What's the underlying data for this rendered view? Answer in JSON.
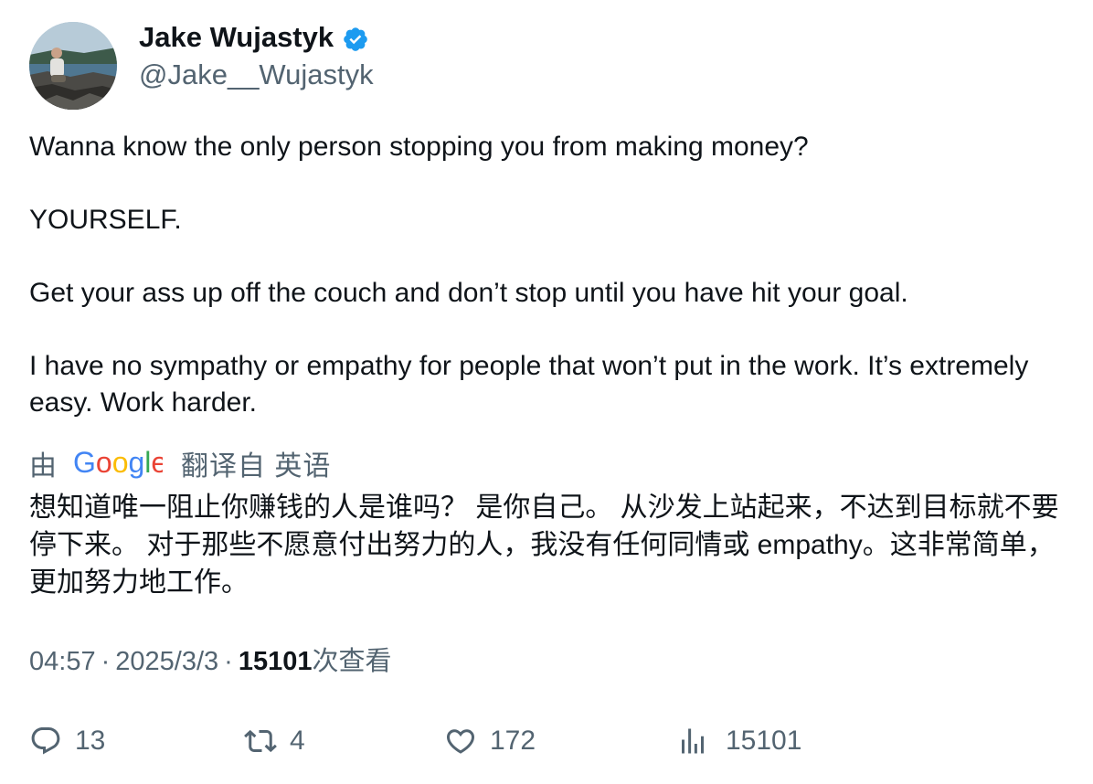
{
  "author": {
    "display_name": "Jake Wujastyk",
    "handle": "@Jake__Wujastyk",
    "verified": true,
    "verified_color": "#1d9bf0"
  },
  "tweet": {
    "paragraphs": [
      "Wanna know the only person stopping you from making money?",
      "YOURSELF.",
      "Get your ass up off the couch and don’t stop until you have hit your goal.",
      "I have no sympathy or empathy for people that won’t put in the work. It’s extremely easy. Work harder."
    ]
  },
  "translation": {
    "by_label": "由",
    "provider": "Google",
    "from_label": "翻译自 英语",
    "text": "想知道唯一阻止你赚钱的人是谁吗？ 是你自己。 从沙发上站起来，不达到目标就不要停下来。 对于那些不愿意付出努力的人，我没有任何同情或 empathy。这非常简单，更加努力地工作。"
  },
  "meta": {
    "time": "04:57",
    "separator": "·",
    "date": "2025/3/3",
    "views_count": "15101",
    "views_label": "次查看"
  },
  "actions": {
    "replies": "13",
    "retweets": "4",
    "likes": "172",
    "views": "15101"
  },
  "icons": {
    "reply": "reply-icon",
    "retweet": "retweet-icon",
    "like": "heart-icon",
    "views": "views-chart-icon",
    "verified": "verified-badge-icon"
  },
  "colors": {
    "text": "#0f1419",
    "secondary": "#536471",
    "accent": "#1d9bf0"
  }
}
